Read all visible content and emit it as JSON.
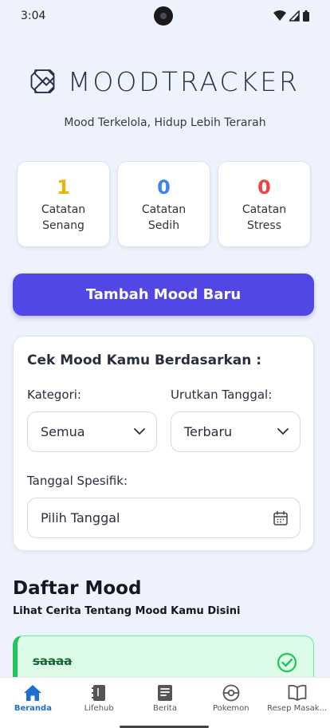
{
  "status": {
    "time": "3:04"
  },
  "app": {
    "logo_text": "MOODTRACKER",
    "tagline": "Mood Terkelola, Hidup Lebih Terarah"
  },
  "stats": [
    {
      "value": "1",
      "label_line1": "Catatan",
      "label_line2": "Senang",
      "color": "#eab308"
    },
    {
      "value": "0",
      "label_line1": "Catatan",
      "label_line2": "Sedih",
      "color": "#3b82f6"
    },
    {
      "value": "0",
      "label_line1": "Catatan",
      "label_line2": "Stress",
      "color": "#ef4444"
    }
  ],
  "add_button": {
    "label": "Tambah Mood Baru",
    "color": "#5047e5"
  },
  "filter": {
    "title": "Cek Mood Kamu Berdasarkan :",
    "category_label": "Kategori:",
    "category_value": "Semua",
    "sort_label": "Urutkan Tanggal:",
    "sort_value": "Terbaru",
    "date_label": "Tanggal Spesifik:",
    "date_placeholder": "Pilih Tanggal"
  },
  "mood_list": {
    "title": "Daftar Mood",
    "subtitle": "Lihat Cerita Tentang Mood Kamu Disini",
    "items": [
      {
        "title": "saaaa",
        "status": "done",
        "accent": "#22c55e"
      }
    ]
  },
  "bottom_nav": [
    {
      "label": "Beranda",
      "icon": "home-icon",
      "active": true
    },
    {
      "label": "Lifehub",
      "icon": "notebook-icon",
      "active": false
    },
    {
      "label": "Berita",
      "icon": "news-icon",
      "active": false
    },
    {
      "label": "Pokemon",
      "icon": "pokeball-icon",
      "active": false
    },
    {
      "label": "Resep Masak...",
      "icon": "book-open-icon",
      "active": false
    }
  ]
}
